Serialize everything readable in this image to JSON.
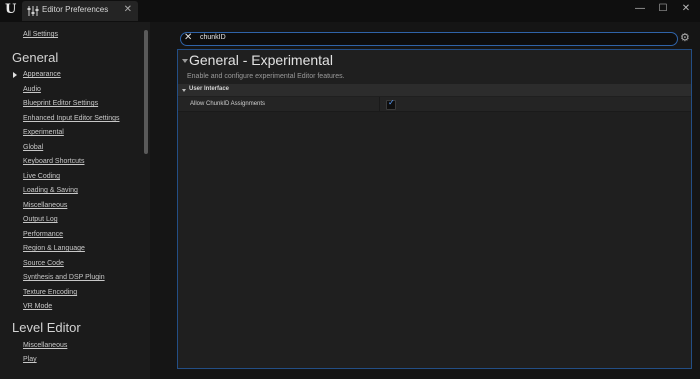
{
  "window": {
    "logo": "U",
    "tab_label": "Editor Preferences",
    "tab_icon": "sliders-icon",
    "controls": [
      "—",
      "☐",
      "✕"
    ]
  },
  "sidebar": {
    "all_settings": "All Settings",
    "general_heading": "General",
    "general_items": [
      "Appearance",
      "Audio",
      "Blueprint Editor Settings",
      "Enhanced Input Editor Settings",
      "Experimental",
      "Global",
      "Keyboard Shortcuts",
      "Live Coding",
      "Loading & Saving",
      "Miscellaneous",
      "Output Log",
      "Performance",
      "Region & Language",
      "Source Code",
      "Synthesis and DSP Plugin",
      "Texture Encoding",
      "VR Mode"
    ],
    "level_editor_heading": "Level Editor",
    "level_editor_items": [
      "Miscellaneous",
      "Play"
    ]
  },
  "search": {
    "value": "chunkID"
  },
  "panel": {
    "title": "General - Experimental",
    "description": "Enable and configure experimental Editor features.",
    "category": "User Interface",
    "property_label": "Allow ChunkID Assignments",
    "property_checked": true
  }
}
